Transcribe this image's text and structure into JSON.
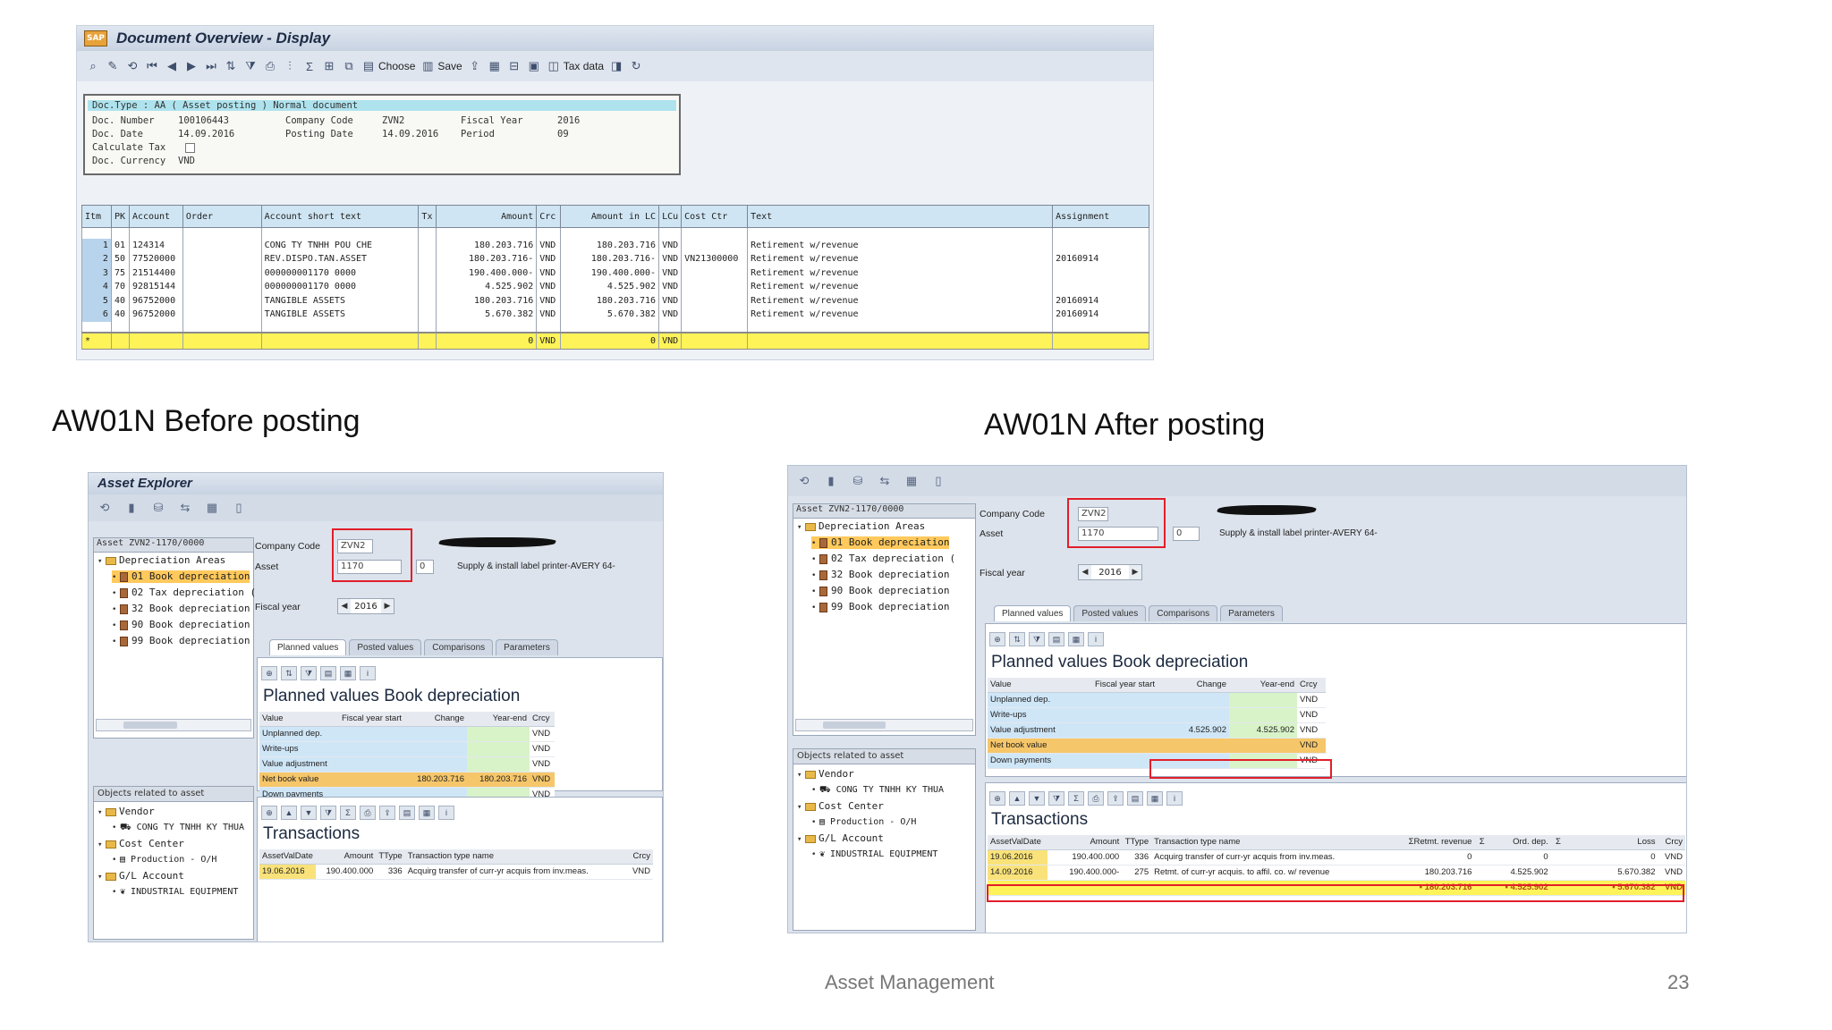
{
  "doc_window": {
    "sap_logo": "SAP",
    "title": "Document Overview - Display",
    "toolbar": {
      "choose": "Choose",
      "save": "Save",
      "tax_data": "Tax data"
    },
    "header": {
      "doc_type_line": "Doc.Type : AA ( Asset posting ) Normal document",
      "doc_number_label": "Doc. Number",
      "doc_number": "100106443",
      "company_code_label": "Company Code",
      "company_code": "ZVN2",
      "fiscal_year_label": "Fiscal Year",
      "fiscal_year": "2016",
      "doc_date_label": "Doc. Date",
      "doc_date": "14.09.2016",
      "posting_date_label": "Posting Date",
      "posting_date": "14.09.2016",
      "period_label": "Period",
      "period": "09",
      "calc_tax_label": "Calculate Tax",
      "doc_currency_label": "Doc. Currency",
      "doc_currency": "VND"
    },
    "table": {
      "columns": [
        "Itm",
        "PK",
        "Account",
        "Order",
        "Account short text",
        "Tx",
        "Amount",
        "Crc",
        "Amount in LC",
        "LCu",
        "Cost Ctr",
        "Text",
        "Assignment"
      ],
      "rows": [
        {
          "itm": "1",
          "pk": "01",
          "account": "124314",
          "order": "",
          "short": "CONG TY TNHH POU CHE",
          "tx": "",
          "amount": "180.203.716",
          "crc": "VND",
          "lc": "180.203.716",
          "lcu": "VND",
          "cc": "",
          "text": "Retirement w/revenue",
          "assign": ""
        },
        {
          "itm": "2",
          "pk": "50",
          "account": "77520000",
          "order": "",
          "short": "REV.DISPO.TAN.ASSET",
          "tx": "",
          "amount": "180.203.716-",
          "crc": "VND",
          "lc": "180.203.716-",
          "lcu": "VND",
          "cc": "VN21300000",
          "text": "Retirement w/revenue",
          "assign": "20160914"
        },
        {
          "itm": "3",
          "pk": "75",
          "account": "21514400",
          "order": "",
          "short": "000000001170 0000",
          "tx": "",
          "amount": "190.400.000-",
          "crc": "VND",
          "lc": "190.400.000-",
          "lcu": "VND",
          "cc": "",
          "text": "Retirement w/revenue",
          "assign": ""
        },
        {
          "itm": "4",
          "pk": "70",
          "account": "92815144",
          "order": "",
          "short": "000000001170 0000",
          "tx": "",
          "amount": "4.525.902",
          "crc": "VND",
          "lc": "4.525.902",
          "lcu": "VND",
          "cc": "",
          "text": "Retirement w/revenue",
          "assign": ""
        },
        {
          "itm": "5",
          "pk": "40",
          "account": "96752000",
          "order": "",
          "short": "TANGIBLE ASSETS",
          "tx": "",
          "amount": "180.203.716",
          "crc": "VND",
          "lc": "180.203.716",
          "lcu": "VND",
          "cc": "",
          "text": "Retirement w/revenue",
          "assign": "20160914"
        },
        {
          "itm": "6",
          "pk": "40",
          "account": "96752000",
          "order": "",
          "short": "TANGIBLE ASSETS",
          "tx": "",
          "amount": "5.670.382",
          "crc": "VND",
          "lc": "5.670.382",
          "lcu": "VND",
          "cc": "",
          "text": "Retirement w/revenue",
          "assign": "20160914"
        }
      ],
      "total": {
        "marker": "*",
        "amount": "0",
        "crc": "VND",
        "lc": "0",
        "lcu": "VND"
      }
    }
  },
  "labels": {
    "before": "AW01N Before posting",
    "after": "AW01N After posting"
  },
  "footer": {
    "text": "Asset Management",
    "page": "23"
  },
  "before": {
    "title": "Asset Explorer",
    "tree_head": "Asset ZVN2-1170/0000",
    "tree": [
      "Depreciation Areas",
      "01 Book depreciation",
      "02 Tax depreciation (",
      "32 Book depreciation",
      "90 Book depreciation",
      "99 Book depreciation"
    ],
    "objects_head": "Objects related to asset",
    "objects": [
      "Vendor",
      "CONG TY TNHH KY THUA",
      "Cost Center",
      "Production - O/H",
      "G/L Account",
      "INDUSTRIAL EQUIPMENT"
    ],
    "company_code_label": "Company Code",
    "company_code": "ZVN2",
    "asset_label": "Asset",
    "asset": "1170",
    "sub": "0",
    "asset_desc": "Supply & install label printer-AVERY 64-",
    "fiscal_year_label": "Fiscal year",
    "fiscal_year": "2016",
    "tabs": [
      "Planned values",
      "Posted values",
      "Comparisons",
      "Parameters"
    ],
    "pane_title": "Planned values Book depreciation",
    "grid_cols": [
      "Value",
      "Fiscal year start",
      "Change",
      "Year-end",
      "Crcy"
    ],
    "grid_rows": [
      {
        "name": "Unplanned dep.",
        "start": "",
        "change": "",
        "end": "",
        "crcy": "VND"
      },
      {
        "name": "Write-ups",
        "start": "",
        "change": "",
        "end": "",
        "crcy": "VND"
      },
      {
        "name": "Value adjustment",
        "start": "",
        "change": "",
        "end": "",
        "crcy": "VND"
      },
      {
        "name": "Net book value",
        "start": "",
        "change": "180.203.716",
        "end": "180.203.716",
        "crcy": "VND"
      },
      {
        "name": "Down payments",
        "start": "",
        "change": "",
        "end": "",
        "crcy": "VND"
      }
    ],
    "trans_title": "Transactions",
    "trans_cols": [
      "AssetValDate",
      "Amount",
      "TType",
      "Transaction type name",
      "Crcy"
    ],
    "trans_rows": [
      {
        "date": "19.06.2016",
        "amount": "190.400.000",
        "ttype": "336",
        "name": "Acquirg transfer of curr-yr acquis from inv.meas.",
        "crcy": "VND"
      }
    ]
  },
  "after": {
    "tree_head": "Asset ZVN2-1170/0000",
    "tree": [
      "Depreciation Areas",
      "01 Book depreciation",
      "02 Tax depreciation (",
      "32 Book depreciation",
      "90 Book depreciation",
      "99 Book depreciation"
    ],
    "objects_head": "Objects related to asset",
    "objects": [
      "Vendor",
      "CONG TY TNHH KY THUA",
      "Cost Center",
      "Production - O/H",
      "G/L Account",
      "INDUSTRIAL EQUIPMENT"
    ],
    "company_code_label": "Company Code",
    "company_code": "ZVN2",
    "asset_label": "Asset",
    "asset": "1170",
    "sub": "0",
    "asset_desc": "Supply & install label printer-AVERY 64-",
    "fiscal_year_label": "Fiscal year",
    "fiscal_year": "2016",
    "tabs": [
      "Planned values",
      "Posted values",
      "Comparisons",
      "Parameters"
    ],
    "pane_title": "Planned values Book depreciation",
    "grid_cols": [
      "Value",
      "Fiscal year start",
      "Change",
      "Year-end",
      "Crcy"
    ],
    "grid_rows": [
      {
        "name": "Unplanned dep.",
        "start": "",
        "change": "",
        "end": "",
        "crcy": "VND"
      },
      {
        "name": "Write-ups",
        "start": "",
        "change": "",
        "end": "",
        "crcy": "VND"
      },
      {
        "name": "Value adjustment",
        "start": "",
        "change": "4.525.902",
        "end": "4.525.902",
        "crcy": "VND"
      },
      {
        "name": "Net book value",
        "start": "",
        "change": "",
        "end": "",
        "crcy": "VND"
      },
      {
        "name": "Down payments",
        "start": "",
        "change": "",
        "end": "",
        "crcy": "VND"
      }
    ],
    "trans_title": "Transactions",
    "trans_cols": [
      "AssetValDate",
      "Amount",
      "TType",
      "Transaction type name",
      "ΣRetmt. revenue",
      "Σ",
      "Ord. dep.",
      "Σ",
      "Loss",
      "Crcy"
    ],
    "trans_rows": [
      {
        "date": "19.06.2016",
        "amount": "190.400.000",
        "ttype": "336",
        "name": "Acquirg transfer of curr-yr acquis from inv.meas.",
        "rev": "0",
        "ord": "0",
        "loss": "0",
        "crcy": "VND"
      },
      {
        "date": "14.09.2016",
        "amount": "190.400.000-",
        "ttype": "275",
        "name": "Retmt. of curr-yr acquis. to affil. co. w/ revenue",
        "rev": "180.203.716",
        "ord": "4.525.902",
        "loss": "5.670.382",
        "crcy": "VND"
      }
    ],
    "trans_total": {
      "rev": "▪ 180.203.716",
      "ord": "▪ 4.525.902",
      "loss": "▪ 5.670.382",
      "crcy": "VND"
    }
  }
}
